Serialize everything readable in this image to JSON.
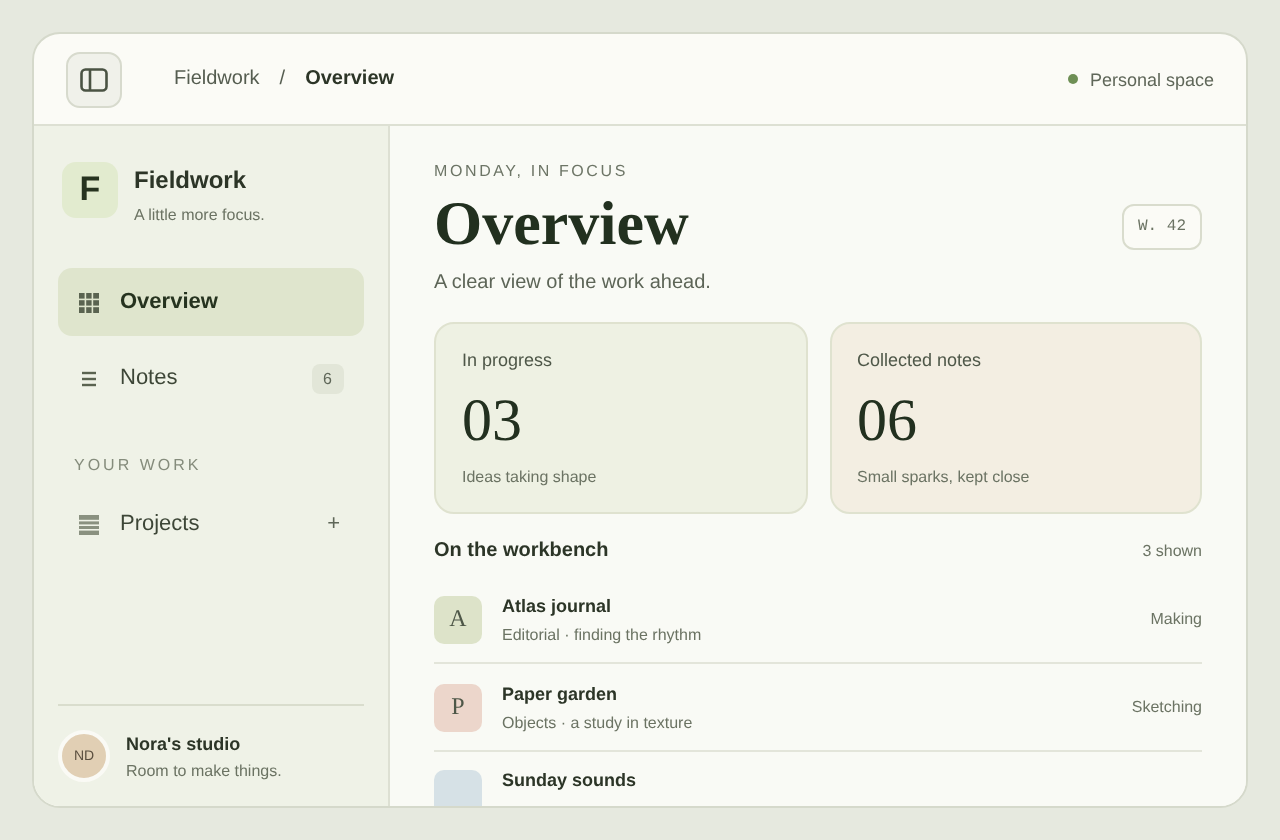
{
  "topbar": {
    "breadcrumbs": [
      {
        "label": "Fieldwork",
        "current": false
      },
      {
        "label": "Overview",
        "current": true
      }
    ],
    "separator": "/",
    "space": {
      "label": "Personal space",
      "color": "#6e8f55"
    }
  },
  "sidebar": {
    "brand": {
      "mark": "F",
      "name": "Fieldwork",
      "tagline": "A little more focus."
    },
    "items": [
      {
        "label": "Overview",
        "kind": "grid",
        "selected": true
      },
      {
        "label": "Notes",
        "kind": "list",
        "selected": false,
        "count": "6"
      }
    ],
    "section": "YOUR WORK",
    "work_items": [
      {
        "label": "Projects",
        "kind": "stack",
        "selected": false,
        "action": "+"
      }
    ],
    "profile": {
      "initials": "ND",
      "name": "Nora's studio",
      "tagline": "Room to make things."
    }
  },
  "main": {
    "eyebrow": "MONDAY, IN FOCUS",
    "title": "Overview",
    "week": "W. 42",
    "subtitle": "A clear view of the work ahead.",
    "stats": [
      {
        "label": "In progress",
        "value": "03",
        "caption": "Ideas taking shape",
        "color": "#eef1e3"
      },
      {
        "label": "Collected notes",
        "value": "06",
        "caption": "Small sparks, kept close",
        "color": "#f3eee2"
      }
    ],
    "list_title": "On the workbench",
    "list_count": "3 shown",
    "rows": [
      {
        "letter": "A",
        "title": "Atlas journal",
        "subtitle": "Editorial · finding the rhythm",
        "status": "Making",
        "color": "#dde3c9"
      },
      {
        "letter": "P",
        "title": "Paper garden",
        "subtitle": "Objects · a study in texture",
        "status": "Sketching",
        "color": "#ecd6cb"
      },
      {
        "title": "Sunday sounds",
        "color": "#d6e1e6"
      }
    ]
  }
}
